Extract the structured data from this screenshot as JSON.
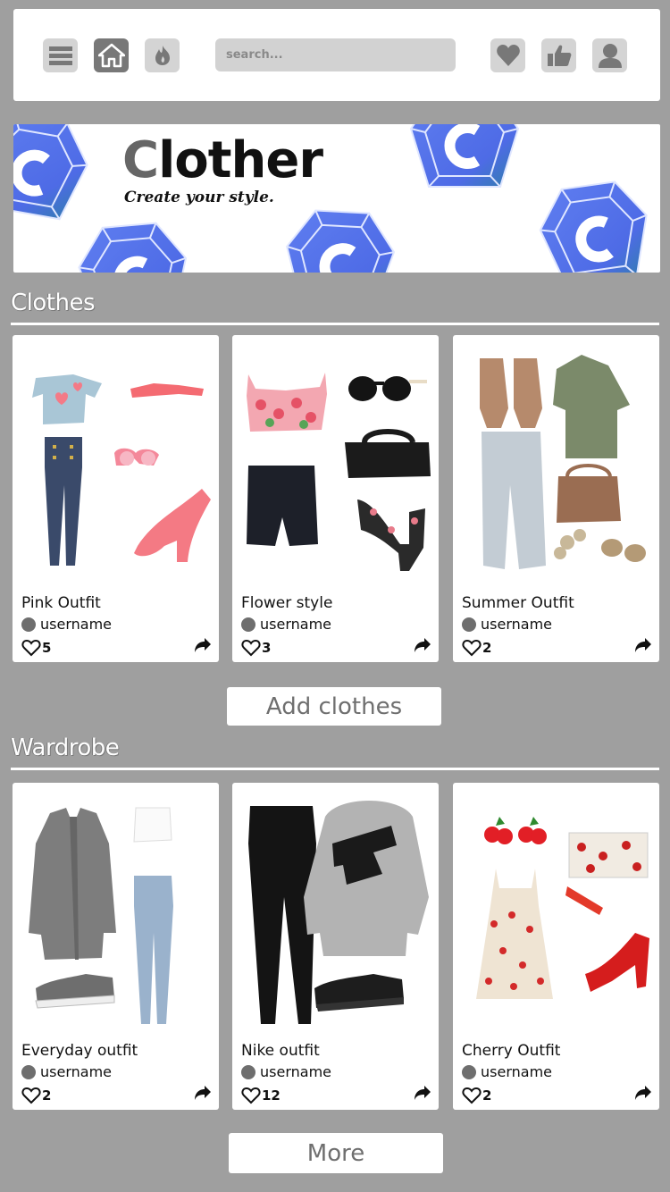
{
  "search": {
    "placeholder": "search..."
  },
  "nav": {
    "icons": [
      "menu-icon",
      "home-icon",
      "flame-icon",
      "heart-icon",
      "thumbs-up-icon",
      "user-icon"
    ]
  },
  "banner": {
    "brand_first": "C",
    "brand_rest": "lother",
    "tagline": "Create your style."
  },
  "clothes": {
    "title": "Clothes",
    "cards": [
      {
        "title": "Pink Outfit",
        "user": "username",
        "likes": "5"
      },
      {
        "title": "Flower style",
        "user": "username",
        "likes": "3"
      },
      {
        "title": "Summer Outfit",
        "user": "username",
        "likes": "2"
      }
    ],
    "add_label": "Add clothes"
  },
  "wardrobe": {
    "title": "Wardrobe",
    "cards": [
      {
        "title": "Everyday outfit",
        "user": "username",
        "likes": "2"
      },
      {
        "title": "Nike outfit",
        "user": "username",
        "likes": "12"
      },
      {
        "title": "Cherry Outfit",
        "user": "username",
        "likes": "2"
      }
    ],
    "more_label": "More"
  },
  "colors": {
    "background": "#9f9f9f",
    "brand_blue": "#4d6ee8",
    "icon_gray": "#787878"
  }
}
